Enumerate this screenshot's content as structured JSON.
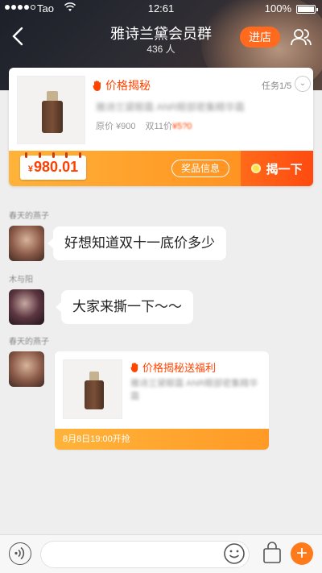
{
  "status_bar": {
    "carrier": "Tao",
    "time": "12:61",
    "battery_pct": "100%"
  },
  "header": {
    "title": "雅诗兰黛会员群",
    "subtitle": "436 人",
    "enter_label": "进店"
  },
  "task_card": {
    "tag": "价格揭秘",
    "progress": "任务1/5",
    "desc": "雅诗兰黛眼霜 ANR眼部密集精华霜",
    "original_price_label": "原价 ¥900",
    "d11_label": "双11价",
    "d11_value": "¥5?0",
    "calendar_symbol": "¥",
    "calendar_value": "980.01",
    "prize_info_label": "奖品信息",
    "reveal_label": "揭一下"
  },
  "messages": [
    {
      "sender": "春天的燕子",
      "text": "好想知道双十一底价多少"
    },
    {
      "sender": "木与阳",
      "text": "大家来撕一下～～"
    },
    {
      "sender": "春天的燕子"
    }
  ],
  "promo_card": {
    "tag": "价格揭秘送福利",
    "desc": "雅诗兰黛眼霜 ANR眼部密集精华霜",
    "footer": "8月8日19:00开抢"
  },
  "bottom_bar": {
    "input_placeholder": ""
  },
  "colors": {
    "accent": "#ff6a1e",
    "price_red": "#ff4400",
    "card_gradient_start": "#ffb33a",
    "card_gradient_end": "#ff8a1e"
  }
}
